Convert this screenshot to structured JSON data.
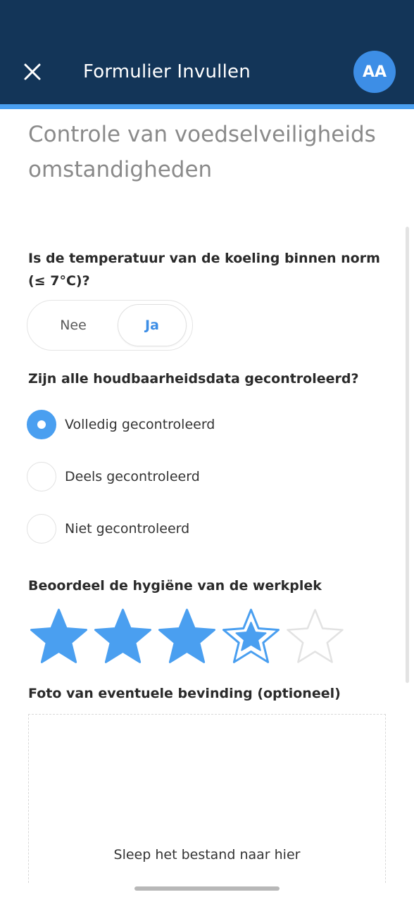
{
  "header": {
    "title": "Formulier Invullen",
    "avatar_initials": "AA",
    "close_icon": "close-icon",
    "background_color": "#133558",
    "accent_color": "#4a9ff0"
  },
  "form": {
    "title": "Controle van voedselveiligheidsomstandigheden",
    "questions": [
      {
        "label": "Is de temperatuur van de koeling binnen norm (≤ 7°C)?",
        "type": "toggle",
        "options": [
          "Nee",
          "Ja"
        ],
        "selected": "Ja"
      },
      {
        "label": "Zijn alle houdbaarheidsdata gecontroleerd?",
        "type": "radio",
        "options": [
          "Volledig gecontroleerd",
          "Deels gecontroleerd",
          "Niet gecontroleerd"
        ],
        "selected": "Volledig gecontroleerd"
      },
      {
        "label": "Beoordeel de hygiëne van de werkplek",
        "type": "rating",
        "max": 5,
        "value": 3,
        "hover": 4
      },
      {
        "label": "Foto van eventuele bevinding (optioneel)",
        "type": "upload",
        "dropzone_text": "Sleep het bestand naar hier"
      }
    ]
  }
}
